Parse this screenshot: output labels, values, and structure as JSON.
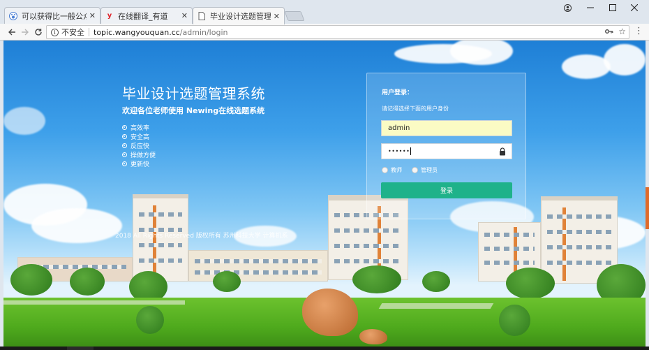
{
  "browser": {
    "tabs": [
      {
        "title": "可以获得比一般公众号",
        "favicon": "paw-icon"
      },
      {
        "title": "在线翻译_有道",
        "favicon": "youdao-icon"
      },
      {
        "title": "毕业设计选题管理系统 -",
        "favicon": "page-icon"
      }
    ],
    "active_tab": 2,
    "address": {
      "security_label": "不安全",
      "host": "topic.wangyouquan.cc",
      "path": "/admin/login"
    }
  },
  "page": {
    "system_title": "毕业设计选题管理系统",
    "welcome": "欢迎各位老师使用 Newing在线选题系统",
    "features": [
      "高效率",
      "安全高",
      "反应快",
      "操做方便",
      "更新快"
    ],
    "copyright": "2018 All Rights Reserved 版权所有 苏州科技大学 计算机系"
  },
  "login": {
    "heading": "用户登录：",
    "hint": "请记得选择下面的用户身份",
    "username": "admin",
    "password_mask": "••••••",
    "roles": [
      "教师",
      "管理员"
    ],
    "submit_label": "登录"
  },
  "colors": {
    "accent_button": "#1fb28a",
    "username_field_bg": "#fbfbc4"
  }
}
